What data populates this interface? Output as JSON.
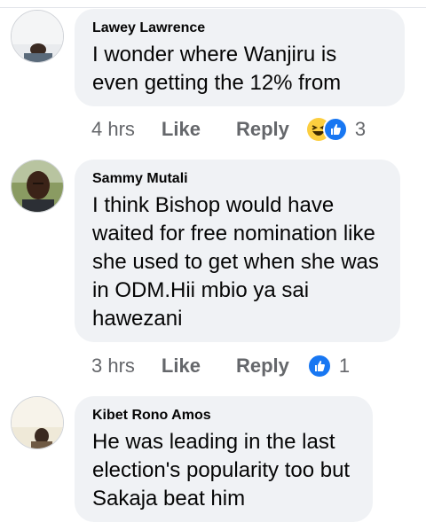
{
  "comments": [
    {
      "author": "Lawey Lawrence",
      "text": "I wonder where Wanjiru is even getting the 12% from",
      "time": "4 hrs",
      "like_label": "Like",
      "reply_label": "Reply",
      "reactions": [
        "haha-icon",
        "like-icon"
      ],
      "reaction_count": "3"
    },
    {
      "author": "Sammy Mutali",
      "text": "I think Bishop would have waited for free nomination like she used to get when she was in ODM.Hii mbio ya sai hawezani",
      "time": "3 hrs",
      "like_label": "Like",
      "reply_label": "Reply",
      "reactions": [
        "like-icon"
      ],
      "reaction_count": "1"
    },
    {
      "author": "Kibet Rono Amos",
      "text": "He was leading in the last election's popularity too but Sakaja beat him"
    }
  ],
  "colors": {
    "bubble": "#f0f2f5",
    "meta_text": "#65676b",
    "like_blue": "#1877f2",
    "haha_yellow": "#fcce3f"
  }
}
